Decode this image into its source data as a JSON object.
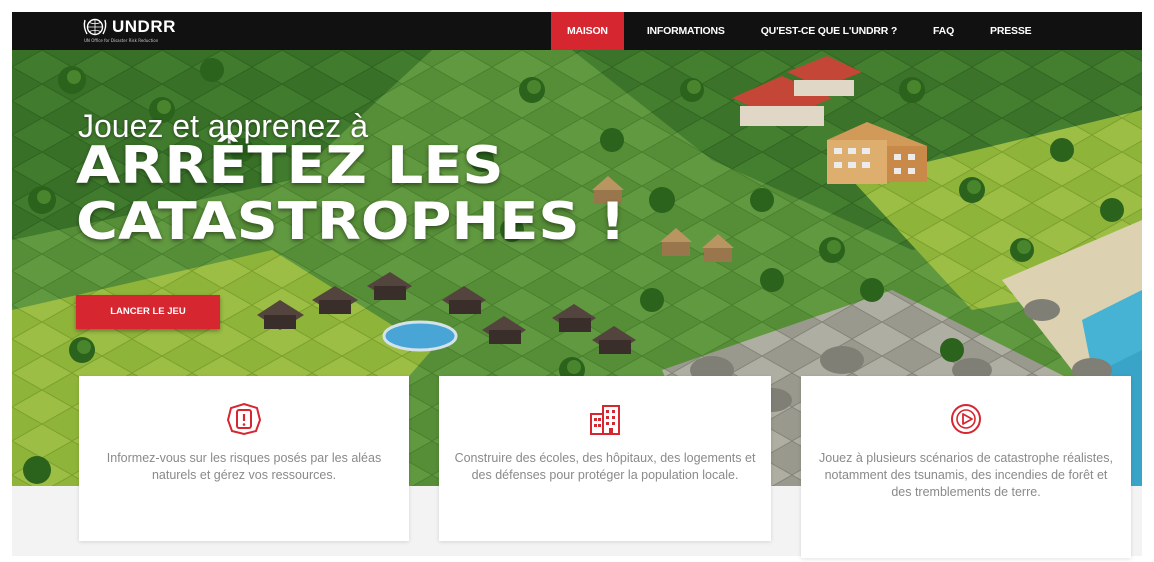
{
  "brand": {
    "name": "UNDRR",
    "tagline": "UN Office for Disaster Risk Reduction",
    "accent_color": "#d62630",
    "navbar_color": "#111111"
  },
  "nav": {
    "items": [
      {
        "label": "MAISON",
        "active": true
      },
      {
        "label": "INFORMATIONS",
        "active": false
      },
      {
        "label": "QU'EST-CE QUE L'UNDRR ?",
        "active": false
      },
      {
        "label": "FAQ",
        "active": false
      },
      {
        "label": "PRESSE",
        "active": false
      }
    ]
  },
  "hero": {
    "line1": "Jouez et apprenez à",
    "line2": "ARRÊTEZ LES",
    "line3": "CATASTROPHES !",
    "cta_label": "LANCER LE JEU"
  },
  "cards": [
    {
      "icon": "alert-circle-icon",
      "text": "Informez-vous sur les risques posés par les aléas naturels et gérez vos ressources."
    },
    {
      "icon": "buildings-icon",
      "text": "Construire des écoles, des hôpitaux, des logements et des défenses pour protéger la population locale."
    },
    {
      "icon": "play-circle-icon",
      "text": "Jouez à plusieurs scénarios de catastrophe réalistes, notamment des tsunamis, des incendies de forêt et des tremblements de terre."
    }
  ]
}
